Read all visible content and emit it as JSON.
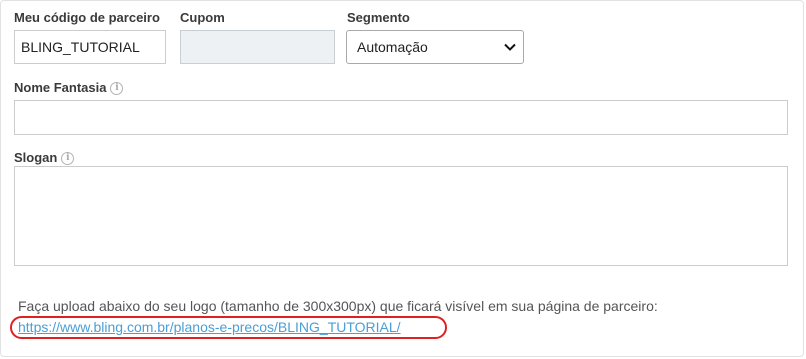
{
  "partner_form": {
    "partner_code": {
      "label": "Meu código de parceiro",
      "value": "BLING_TUTORIAL"
    },
    "coupon": {
      "label": "Cupom",
      "value": ""
    },
    "segment": {
      "label": "Segmento",
      "selected": "Automação"
    },
    "trade_name": {
      "label": "Nome Fantasia",
      "value": ""
    },
    "slogan": {
      "label": "Slogan",
      "value": ""
    },
    "upload_instructions": "Faça upload abaixo do seu logo (tamanho de 300x300px) que ficará visível em sua página de parceiro:",
    "partner_page_link": "https://www.bling.com.br/planos-e-precos/BLING_TUTORIAL/",
    "info_icon_glyph": "i"
  },
  "colors": {
    "link": "#4a9fd6",
    "highlight": "#e02020",
    "disabled_field": "#eef1f4"
  }
}
